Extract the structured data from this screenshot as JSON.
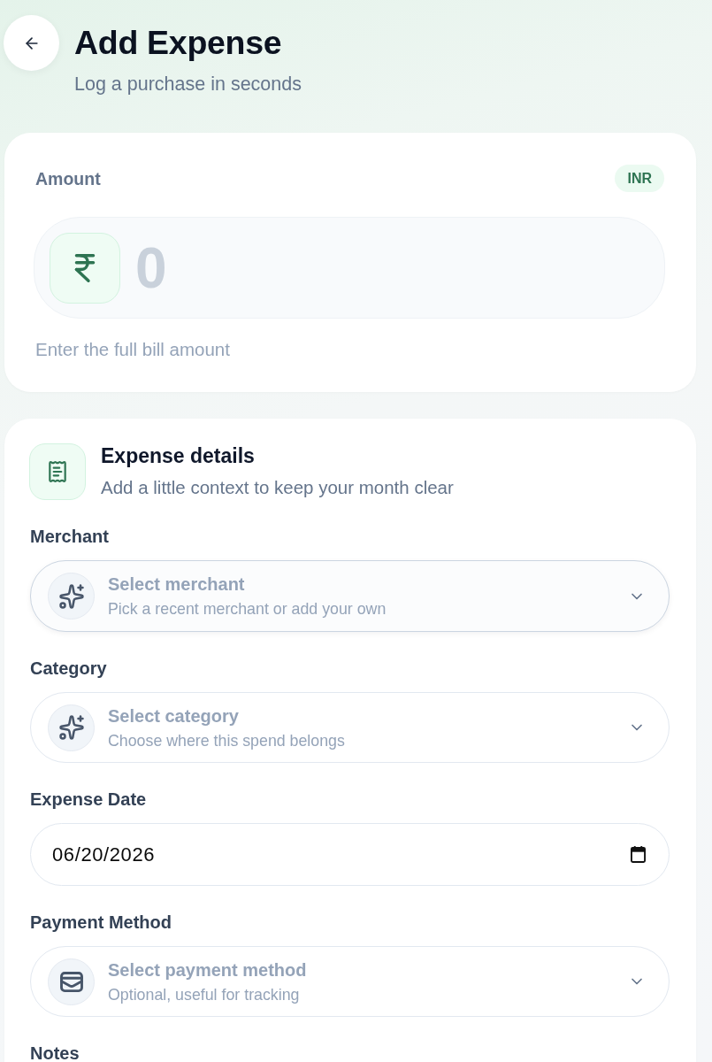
{
  "header": {
    "title": "Add Expense",
    "subtitle": "Log a purchase in seconds"
  },
  "amount_card": {
    "label": "Amount",
    "currency": "INR",
    "amount": {
      "placeholder": "0"
    },
    "hint": "Enter the full bill amount"
  },
  "details_card": {
    "title": "Expense details",
    "subtitle": "Add a little context to keep your month clear",
    "fields": [
      {
        "kind": "select",
        "label": "Merchant",
        "placeholder": "Select merchant",
        "hint": "Pick a recent merchant or add your own",
        "focused": true
      },
      {
        "kind": "select",
        "label": "Category",
        "placeholder": "Select category",
        "hint": "Choose where this spend belongs",
        "focused": false
      },
      {
        "kind": "date",
        "label": "Expense Date",
        "value": "06/20/2026"
      },
      {
        "kind": "select",
        "label": "Payment Method",
        "placeholder": "Select payment method",
        "hint": "Optional, useful for tracking",
        "focused": false
      },
      {
        "kind": "notes",
        "label": "Notes"
      }
    ]
  }
}
